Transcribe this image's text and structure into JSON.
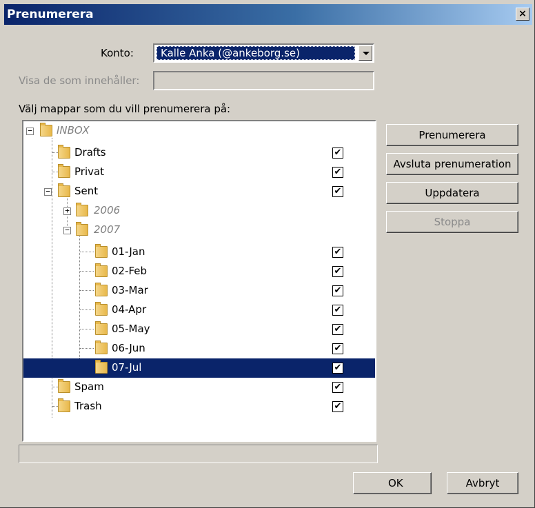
{
  "window": {
    "title": "Prenumerera",
    "close_glyph": "×"
  },
  "form": {
    "account_label": "Konto:",
    "account_value": "Kalle Anka (@ankeborg.se)",
    "filter_label": "Visa de som innehåller:",
    "filter_value": "",
    "folders_label": "Välj mappar som du vill prenumerera på:"
  },
  "tree": {
    "rows": [
      {
        "label": "INBOX",
        "subscribed": false,
        "style": "italic-grey",
        "expander": "minus"
      },
      {
        "label": "Drafts",
        "subscribed": true
      },
      {
        "label": "Privat",
        "subscribed": true
      },
      {
        "label": "Sent",
        "subscribed": true,
        "expander": "minus"
      },
      {
        "label": "2006",
        "subscribed": false,
        "style": "italic-grey",
        "expander": "plus"
      },
      {
        "label": "2007",
        "subscribed": false,
        "style": "italic-grey",
        "expander": "minus"
      },
      {
        "label": "01-Jan",
        "subscribed": true
      },
      {
        "label": "02-Feb",
        "subscribed": true
      },
      {
        "label": "03-Mar",
        "subscribed": true
      },
      {
        "label": "04-Apr",
        "subscribed": true
      },
      {
        "label": "05-May",
        "subscribed": true
      },
      {
        "label": "06-Jun",
        "subscribed": true
      },
      {
        "label": "07-Jul",
        "subscribed": true,
        "selected": true
      },
      {
        "label": "Spam",
        "subscribed": true
      },
      {
        "label": "Trash",
        "subscribed": true
      }
    ],
    "check_glyph": "✔",
    "expander_minus": "−",
    "expander_plus": "+"
  },
  "buttons": {
    "subscribe": "Prenumerera",
    "unsubscribe": "Avsluta prenumeration",
    "update": "Uppdatera",
    "stop": "Stoppa",
    "ok": "OK",
    "cancel": "Avbryt"
  },
  "status_text": "",
  "colors": {
    "selection": "#0a246a",
    "dialog_bg": "#d4d0c8",
    "title_gradient_start": "#0a246a",
    "title_gradient_end": "#a6caf0"
  },
  "icons": {
    "folder": "folder-icon",
    "checkbox": "checkbox-checked-icon",
    "dropdown": "dropdown-arrow-icon"
  }
}
